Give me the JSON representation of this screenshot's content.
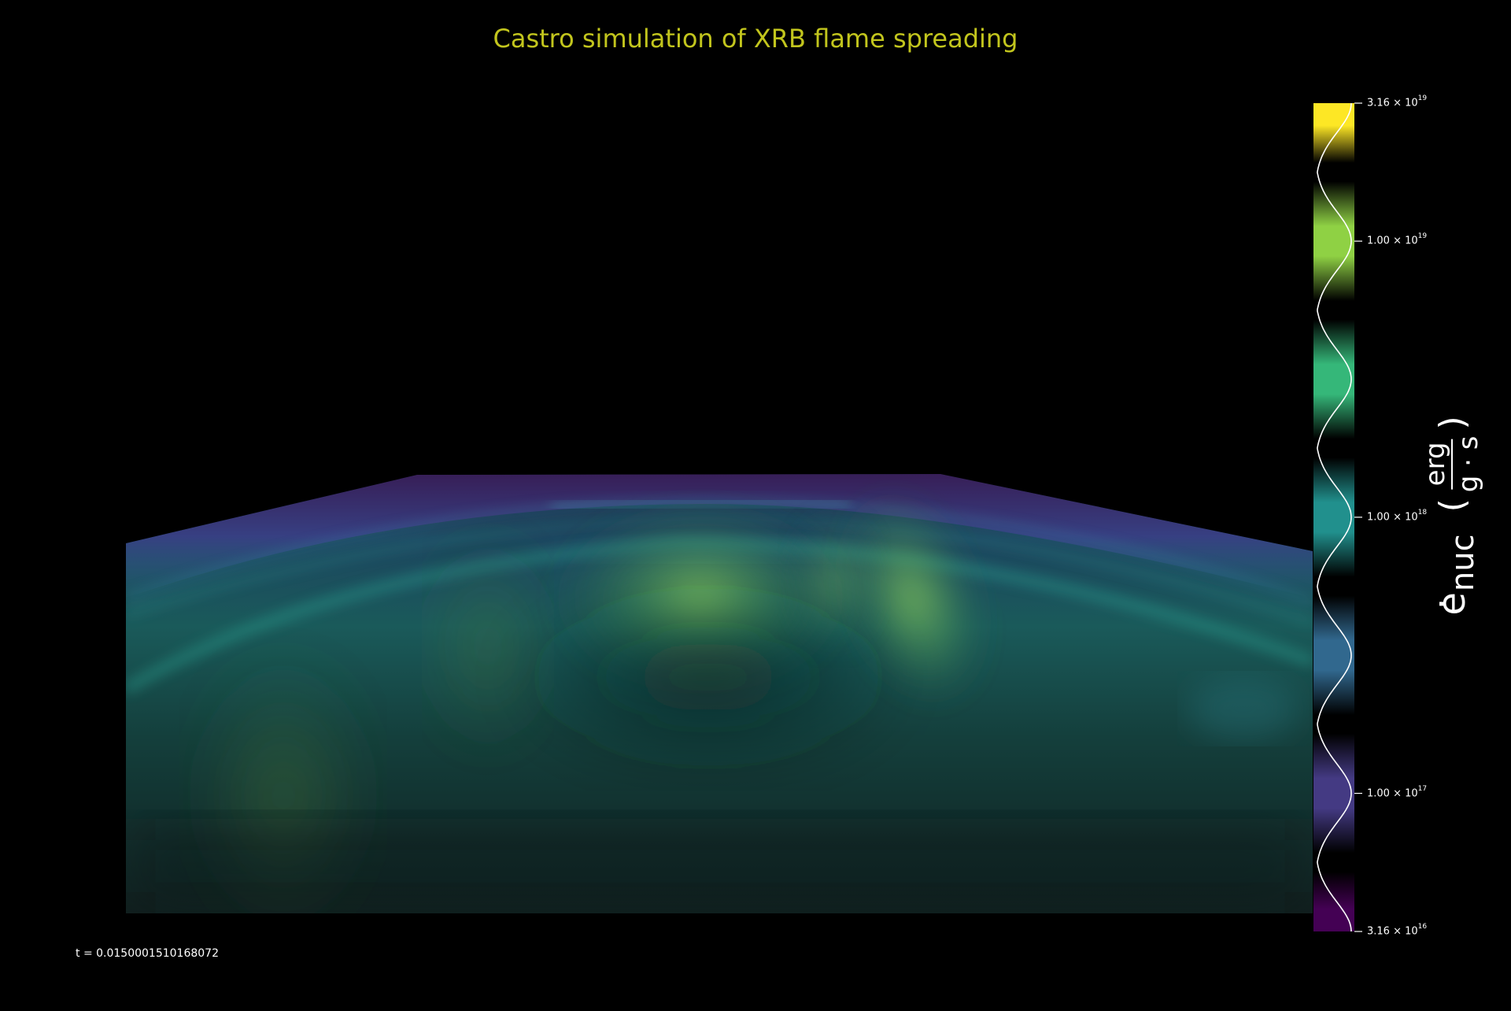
{
  "title": "Castro simulation of XRB flame spreading",
  "title_color": "#c2c51d",
  "text_color": "#ffffff",
  "background_color": "#000000",
  "time_label": "t = 0.0150001510168072",
  "image_content": "volume rendering of flame surface, green-teal glow with purple/blue edges",
  "colorbar": {
    "variable_label_main": "e",
    "variable_label_sub": "nuc",
    "unit_numerator": "erg",
    "unit_denominator": "g · s",
    "scale": "log",
    "ticks": [
      {
        "mantissa": "3.16 × 10",
        "exponent": "19",
        "value": 3.16e+19
      },
      {
        "mantissa": "1.00 × 10",
        "exponent": "19",
        "value": 1e+19
      },
      {
        "mantissa": "1.00 × 10",
        "exponent": "18",
        "value": 1e+18
      },
      {
        "mantissa": "1.00 × 10",
        "exponent": "17",
        "value": 1e+17
      },
      {
        "mantissa": "3.16 × 10",
        "exponent": "16",
        "value": 3.16e+16
      }
    ],
    "bands": [
      {
        "color": "#fde725",
        "value": 3.16e+19
      },
      {
        "color": "#8fd144",
        "value": 1e+19
      },
      {
        "color": "#35b779",
        "value": 3.16e+18
      },
      {
        "color": "#21908d",
        "value": 1e+18
      },
      {
        "color": "#31688e",
        "value": 3.16e+17
      },
      {
        "color": "#443a83",
        "value": 1e+17
      },
      {
        "color": "#440154",
        "value": 3.16e+16
      }
    ]
  }
}
